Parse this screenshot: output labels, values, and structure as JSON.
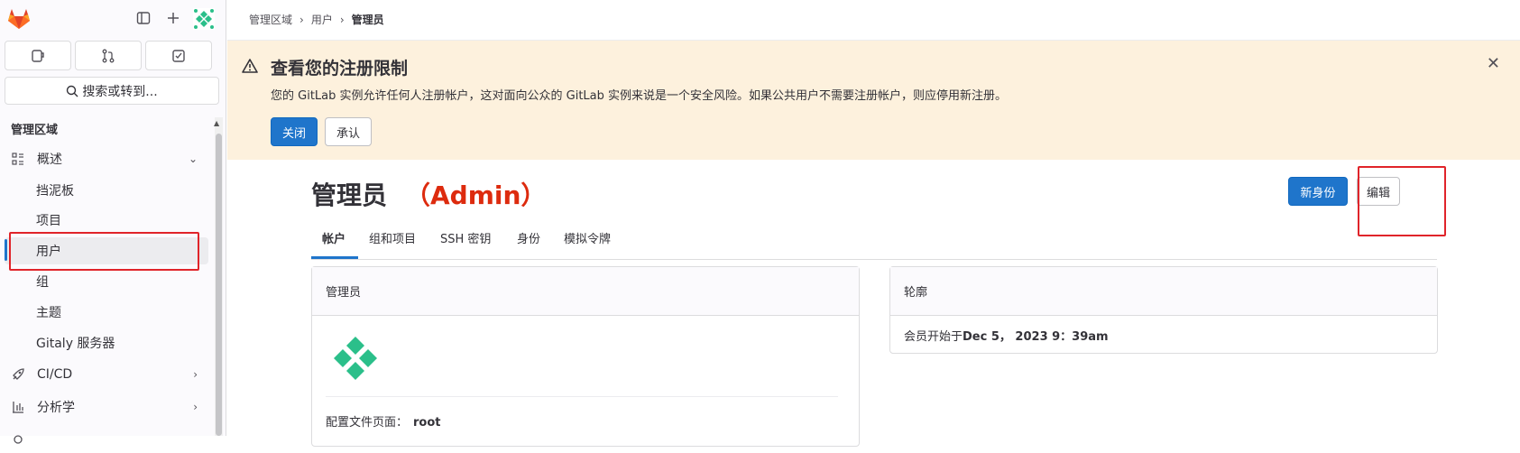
{
  "sidebar": {
    "quick_actions": [
      "issues",
      "merge-requests",
      "todos"
    ],
    "search_label": "搜索或转到...",
    "section_title": "管理区域",
    "overview": {
      "label": "概述"
    },
    "items": [
      {
        "label": "挡泥板"
      },
      {
        "label": "项目"
      },
      {
        "label": "用户"
      },
      {
        "label": "组"
      },
      {
        "label": "主题"
      },
      {
        "label": "Gitaly 服务器"
      }
    ],
    "cicd": {
      "label": "CI/CD"
    },
    "analytics": {
      "label": "分析学"
    }
  },
  "breadcrumb": {
    "items": [
      "管理区域",
      "用户",
      "管理员"
    ]
  },
  "alert": {
    "title": "查看您的注册限制",
    "message": "您的 GitLab 实例允许任何人注册帐户，这对面向公众的 GitLab 实例来说是一个安全风险。如果公共用户不需要注册帐户，则应停用新注册。",
    "close_label": "关闭",
    "ack_label": "承认"
  },
  "page": {
    "title": "管理员",
    "annotation": "（Admin）",
    "new_identity_label": "新身份",
    "edit_label": "编辑"
  },
  "tabs": [
    "帐户",
    "组和项目",
    "SSH 密钥",
    "身份",
    "模拟令牌"
  ],
  "account_card": {
    "title": "管理员",
    "profile_label": "配置文件页面：",
    "profile_value": "root"
  },
  "profile_card": {
    "title": "轮廓",
    "member_since_label": "会员开始于",
    "member_since_value": "Dec 5， 2023 9：39am"
  },
  "colors": {
    "primary": "#1f75cb",
    "alert_bg": "#fdf1dd",
    "annotation": "#e0242a"
  }
}
